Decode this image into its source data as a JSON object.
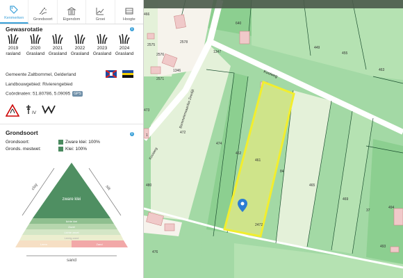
{
  "tabs": [
    {
      "label": "Kenmerken",
      "icon": "tag-icon",
      "active": true
    },
    {
      "label": "Grondsoort",
      "icon": "soil-icon",
      "active": false
    },
    {
      "label": "Eigendom",
      "icon": "landmark-icon",
      "active": false
    },
    {
      "label": "Groei",
      "icon": "growth-chart-icon",
      "active": false
    },
    {
      "label": "Hoogte",
      "icon": "height-icon",
      "active": false
    }
  ],
  "gewasrotatie": {
    "title": "Gewasrotatie",
    "years": [
      {
        "year": "2019",
        "crop": "rasland"
      },
      {
        "year": "2020",
        "crop": "Grasland"
      },
      {
        "year": "2021",
        "crop": "Grasland"
      },
      {
        "year": "2022",
        "crop": "Grasland"
      },
      {
        "year": "2023",
        "crop": "Grasland"
      },
      {
        "year": "2024",
        "crop": "Grasland"
      }
    ]
  },
  "location": {
    "gemeente": "Gemeente Zaltbommel, Gelderland",
    "landbouwgebied": "Landbouwgebied: Rivierengebied",
    "coords": "Coördinaten: 51.80786, 5.09095",
    "gps_label": "GPS"
  },
  "badges": {
    "class_label": "IV"
  },
  "grondsoort": {
    "title": "Grondsoort",
    "rows": [
      {
        "label": "Grondsoort:",
        "value": "Zware klei: 100%"
      },
      {
        "label": "Gronds. mestwet:",
        "value": "Klei: 100%"
      }
    ],
    "triangle": {
      "top_label": "zware klei",
      "layers": [
        "lichte klei",
        "Zavel",
        "Lichte zavel",
        "Lemig zand",
        "Leem",
        "Zand"
      ],
      "left_label": "clay",
      "right_label": "silt",
      "bottom_label": "sand"
    }
  },
  "map": {
    "road_labels": [
      "Kooiweg",
      "Bommelerwaardse Zeedijk",
      "Kooiweg"
    ],
    "parcel_numbers": [
      "640",
      "449",
      "455",
      "463",
      "2575",
      "2576",
      "2578",
      "1346",
      "1347",
      "2571",
      "466",
      "472",
      "473",
      "474",
      "462",
      "461",
      "84",
      "465",
      "469",
      "37",
      "1",
      "480",
      "476",
      "493",
      "494",
      "2472"
    ],
    "selected_parcel": "461",
    "colors": {
      "grass": "#a3d9a5",
      "selected_fill": "#cfe48a",
      "selected_border": "#f2ee2e",
      "road": "#ffffff",
      "field_light": "#e4f1d9",
      "top_bar": "#4a5a4a"
    }
  }
}
